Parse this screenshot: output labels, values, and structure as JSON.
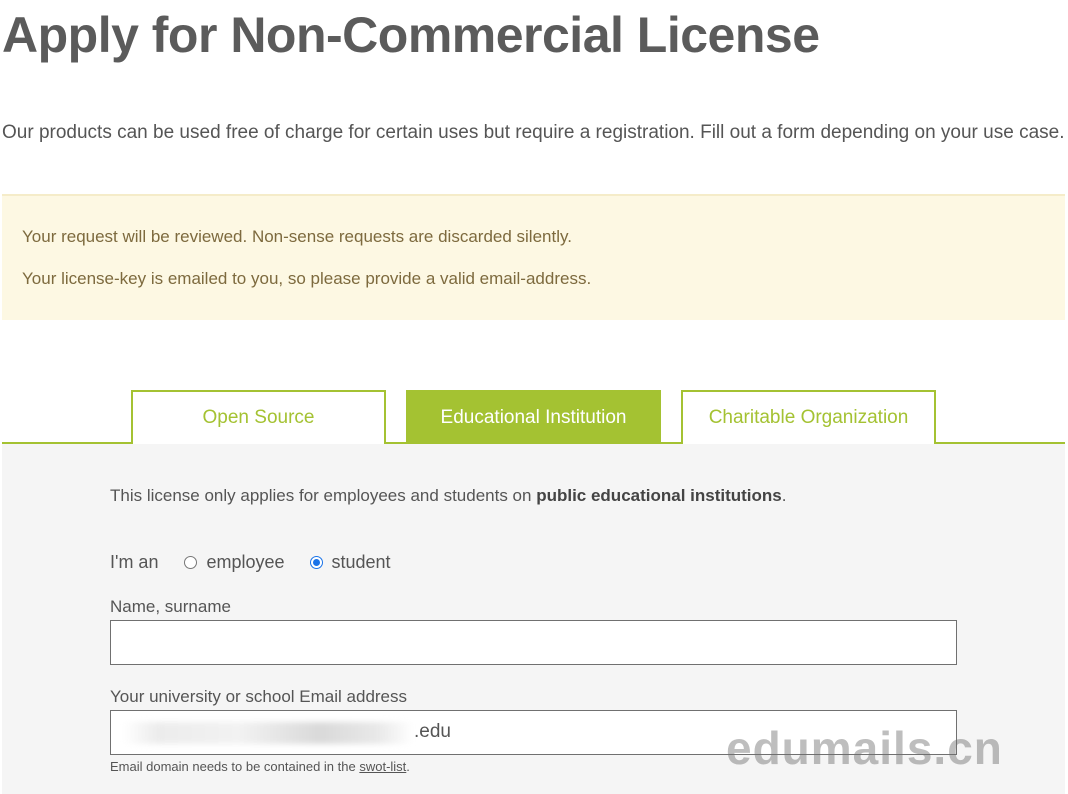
{
  "page": {
    "title": "Apply for Non-Commercial License",
    "intro": "Our products can be used free of charge for certain uses but require a registration. Fill out a form depending on your use case."
  },
  "notice": {
    "line1": "Your request will be reviewed. Non-sense requests are discarded silently.",
    "line2": "Your license-key is emailed to you, so please provide a valid email-address."
  },
  "tabs": [
    {
      "label": "Open Source",
      "active": false
    },
    {
      "label": "Educational Institution",
      "active": true
    },
    {
      "label": "Charitable Organization",
      "active": false
    }
  ],
  "form": {
    "description_prefix": "This license only applies for employees and students on ",
    "description_bold": "public educational institutions",
    "description_suffix": ".",
    "role_label": "I'm an",
    "role_options": [
      {
        "label": "employee",
        "checked": false
      },
      {
        "label": "student",
        "checked": true
      }
    ],
    "name_label": "Name, surname",
    "name_value": "",
    "email_label": "Your university or school Email address",
    "email_value_visible": ".edu",
    "help_prefix": "Email domain needs to be contained in the ",
    "help_link": "swot-list",
    "help_suffix": "."
  },
  "watermark": "edumails.cn",
  "colors": {
    "accent": "#a4c232",
    "notice_bg": "#fdf8e3",
    "notice_text": "#7d6a3e",
    "panel_bg": "#f5f5f5",
    "radio_checked": "#1a73e8"
  }
}
